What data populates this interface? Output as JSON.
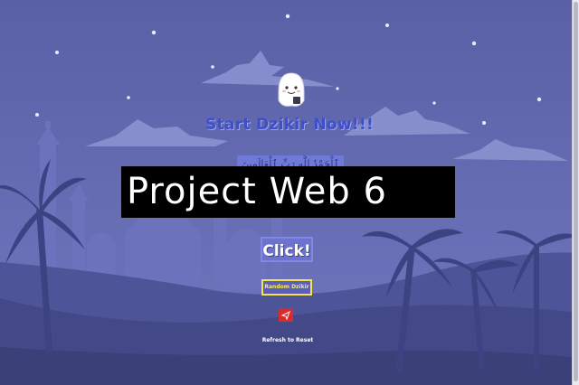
{
  "page": {
    "heading": "Start Dzikir Now!!!",
    "arabic_text": "ٱلْحَمْدُ لِلَّهِ رَبِّ ٱلْعَالَمِينَ",
    "banner_text": "Project Web 6",
    "click_label": "Click!",
    "random_label": "Random Dzikir",
    "refresh_note": "Refresh to Reset"
  },
  "icons": {
    "mascot": "smiling-ghost-mascot",
    "send": "paper-plane-icon"
  },
  "colors": {
    "background": "#5d64a8",
    "heading": "#3f4ec9",
    "accent_yellow": "#f6e24c",
    "send_red": "#d92b2b",
    "banner_bg": "#000000"
  }
}
